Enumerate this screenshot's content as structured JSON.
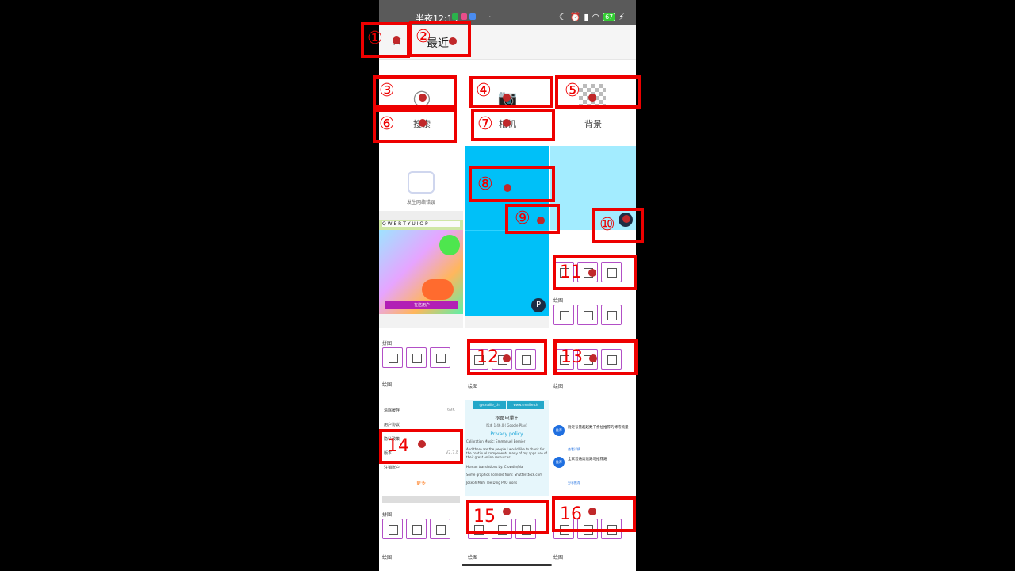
{
  "status_bar": {
    "time": "半夜12:19",
    "extra_dot": "·",
    "battery": "67"
  },
  "top_bar": {
    "title": "最近",
    "back_icon": "close-icon"
  },
  "picker": {
    "options": [
      {
        "label": "搜索",
        "icon": "search-icon"
      },
      {
        "label": "相机",
        "icon": "camera-icon"
      },
      {
        "label": "背景",
        "icon": "checkerboard-icon"
      }
    ]
  },
  "tiles": {
    "error_tile": {
      "message": "发生网络错误"
    },
    "keyboard_row": "Q W E R T Y U I O P",
    "promo_button": "在这用户",
    "settings_tile": {
      "items": [
        "清除缓存",
        "用户协议",
        "隐私政策",
        "版本",
        "注销账户"
      ],
      "cache_value": "69K",
      "version_value": "V2.7.8",
      "highlight": "更多"
    },
    "about_tile": {
      "links": [
        "@smallie_ch",
        "www.smallie.ch"
      ],
      "title": "抠图电量+",
      "version": "版本 1.46.0 ( Google Play)",
      "privacy": "Privacy policy",
      "credits_title": "Calibration Music: Emmanuel Bernier",
      "credits_body": "And there are the people I would like to thank for the continual components many of my apps use of their great online resources:",
      "translations": "Human translations by: Crowdin/bla",
      "graphics": "Some graphics licensed from: Shutterstock.com",
      "joseph": "Joseph Mah: Tee Ding PRO icons"
    },
    "news_tile": {
      "headline1": "附近号量超越数千余位推荐的博客流量",
      "headline2": "全家普通高速路与推荐路",
      "link1": "查看详情",
      "link2": "分享推荐",
      "avatar_text": "推荐"
    },
    "panel": {
      "section_a": "拼图",
      "section_b": "绘图",
      "captions": [
        "布局",
        "自由拼",
        "边框"
      ]
    }
  },
  "annotations": [
    "①",
    "②",
    "③",
    "④",
    "⑤",
    "⑥",
    "⑦",
    "⑧",
    "⑨",
    "⑩",
    "11",
    "12",
    "13",
    "14",
    "15",
    "16"
  ],
  "colors": {
    "accent": "#b24fc6",
    "annotation": "#e00000",
    "sky": "#00c0f8",
    "lightsky": "#a3ecff",
    "statusbar": "#5a5a5a"
  }
}
